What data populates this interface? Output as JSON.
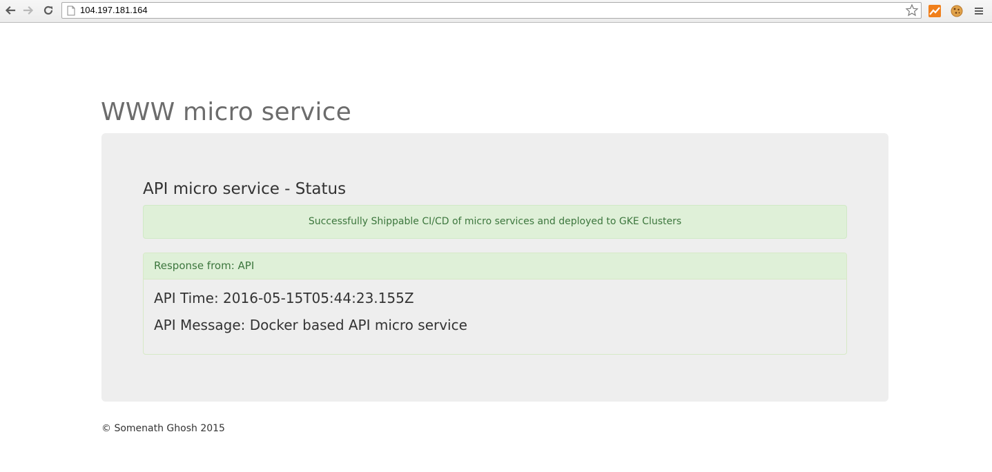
{
  "browser": {
    "url": "104.197.181.164",
    "icons": [
      "back-arrow-icon",
      "forward-arrow-icon",
      "reload-icon",
      "page-icon",
      "star-icon",
      "analytics-extension-icon",
      "cookie-extension-icon",
      "menu-icon"
    ]
  },
  "page": {
    "title": "WWW micro service",
    "status_heading": "API micro service - Status",
    "alert_text": "Successfully Shippable CI/CD of micro services and deployed to GKE Clusters",
    "panel": {
      "heading": "Response from: API",
      "api_time": "API Time: 2016-05-15T05:44:23.155Z",
      "api_message": "API Message: Docker based API micro service"
    },
    "footer": "© Somenath Ghosh 2015"
  },
  "colors": {
    "jumbotron_bg": "#eeeeee",
    "success_bg": "#dff0d8",
    "success_text": "#3c763d",
    "title_text": "#6c6c6c"
  }
}
